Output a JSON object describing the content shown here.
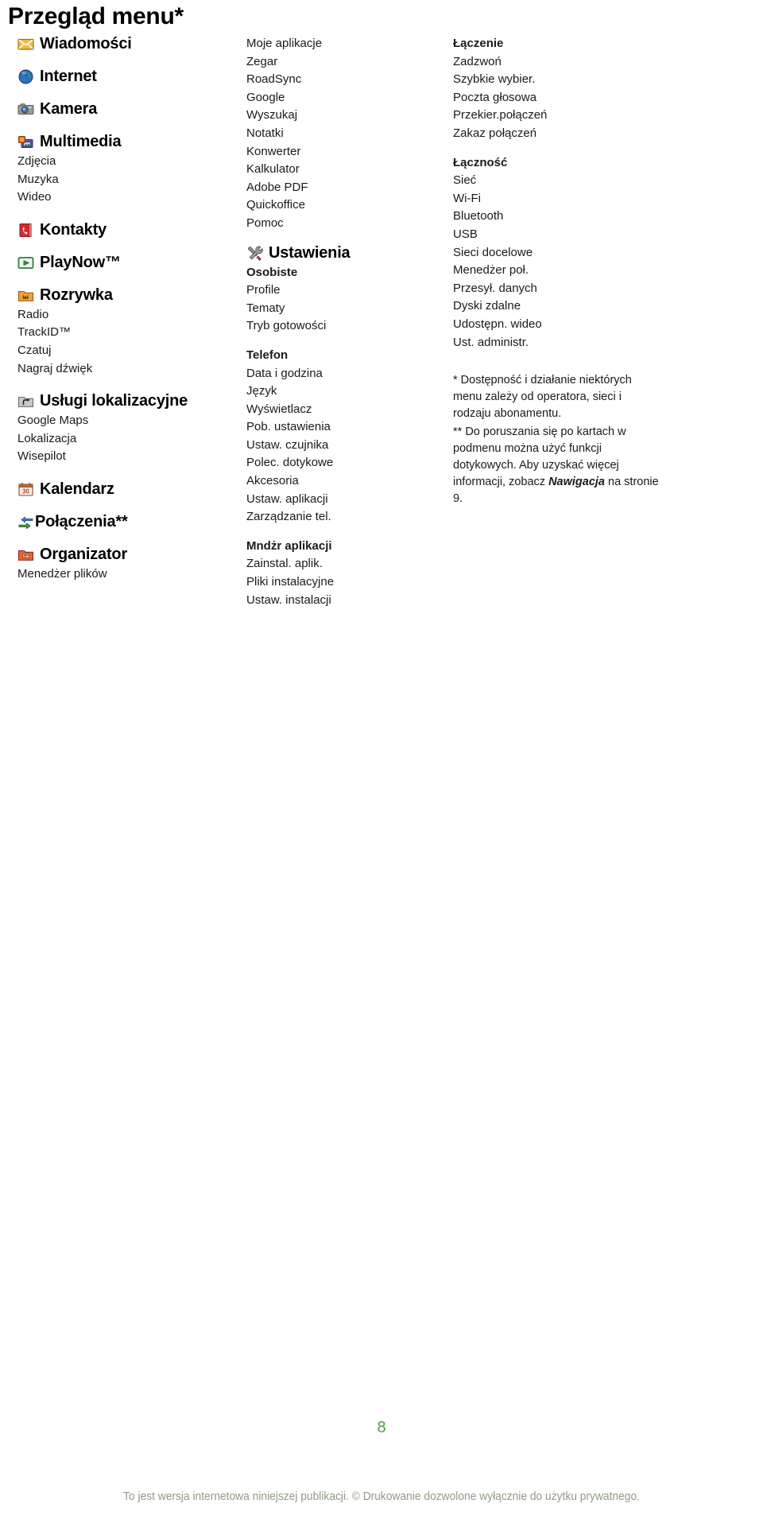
{
  "document": {
    "title": "Przegląd menu*",
    "page_number": "8",
    "footer_note": "To jest wersja internetowa niniejszej publikacji. © Drukowanie dozwolone wyłącznie do użytku prywatnego.",
    "page_number_color": "#4f9a3f",
    "footer_note_color": "#8e9b86"
  },
  "left_column": {
    "groups": [
      {
        "icon": "envelope-icon",
        "heading": "Wiadomości",
        "items": []
      },
      {
        "icon": "globe-icon",
        "heading": "Internet",
        "items": []
      },
      {
        "icon": "camera-icon",
        "heading": "Kamera",
        "items": []
      },
      {
        "icon": "multimedia-icon",
        "heading": "Multimedia",
        "items": [
          "Zdjęcia",
          "Muzyka",
          "Wideo"
        ]
      },
      {
        "icon": "contacts-book-icon",
        "heading": "Kontakty",
        "items": []
      },
      {
        "icon": "play-icon",
        "heading": "PlayNow™",
        "items": []
      },
      {
        "icon": "entertainment-folder-icon",
        "heading": "Rozrywka",
        "items": [
          "Radio",
          "TrackID™",
          "Czatuj",
          "Nagraj dźwięk"
        ]
      },
      {
        "icon": "location-folder-icon",
        "heading": "Usługi lokalizacyjne",
        "items": [
          "Google Maps",
          "Lokalizacja",
          "Wisepilot"
        ]
      },
      {
        "icon": "calendar-icon",
        "heading": "Kalendarz",
        "items": []
      },
      {
        "icon": "calls-arrows-icon",
        "heading": "Połączenia**",
        "items": []
      },
      {
        "icon": "organizer-folder-icon",
        "heading": "Organizator",
        "items": [
          "Menedżer plików"
        ]
      }
    ]
  },
  "middle_column": {
    "apps": {
      "items": [
        "Moje aplikacje",
        "Zegar",
        "RoadSync",
        "Google",
        "Wyszukaj",
        "Notatki",
        "Konwerter",
        "Kalkulator",
        "Adobe PDF",
        "Quickoffice",
        "Pomoc"
      ]
    },
    "settings": {
      "icon": "tools-icon",
      "heading": "Ustawienia",
      "sections": [
        {
          "title": "Osobiste",
          "items": [
            "Profile",
            "Tematy",
            "Tryb gotowości"
          ]
        },
        {
          "title": "Telefon",
          "items": [
            "Data i godzina",
            "Język",
            "Wyświetlacz",
            "Pob. ustawienia",
            "Ustaw. czujnika",
            "Polec. dotykowe",
            "Akcesoria",
            "Ustaw. aplikacji",
            "Zarządzanie tel."
          ]
        },
        {
          "title": "Mndżr aplikacji",
          "items": [
            "Zainstal. aplik.",
            "Pliki instalacyjne",
            "Ustaw. instalacji"
          ]
        }
      ]
    }
  },
  "right_column": {
    "sections": [
      {
        "title": "Łączenie",
        "items": [
          "Zadzwoń",
          "Szybkie wybier.",
          "Poczta głosowa",
          "Przekier.połączeń",
          "Zakaz połączeń"
        ]
      },
      {
        "title": "Łączność",
        "items": [
          "Sieć",
          "Wi-Fi",
          "Bluetooth",
          "USB",
          "Sieci docelowe",
          "Menedżer poł.",
          "Przesył. danych",
          "Dyski zdalne",
          "Udostępn. wideo",
          "Ust. administr."
        ]
      }
    ],
    "footnotes": {
      "single_star": "* Dostępność i działanie niektórych menu zależy od operatora, sieci i rodzaju abonamentu.",
      "double_star_before": "** Do poruszania się po kartach w podmenu można użyć funkcji dotykowych. Aby uzyskać więcej informacji, zobacz ",
      "double_star_italic": "Nawigacja",
      "double_star_after": " na stronie 9."
    }
  }
}
